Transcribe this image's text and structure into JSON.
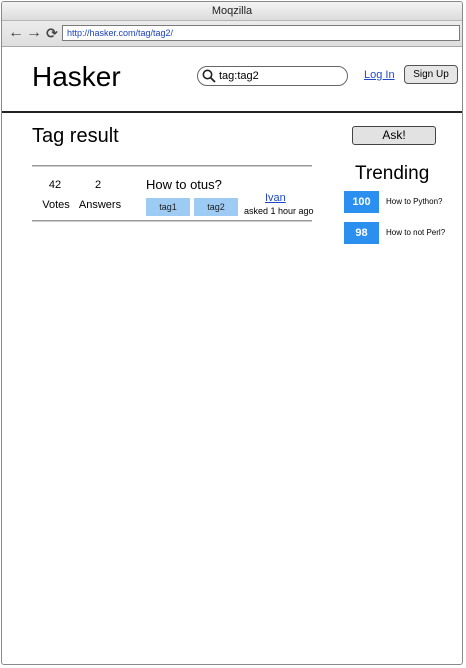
{
  "browser": {
    "title": "Moqzilla",
    "url": "http://hasker.com/tag/tag2/"
  },
  "header": {
    "brand": "Hasker",
    "search_value": "tag:tag2",
    "login_label": "Log In",
    "signup_label": "Sign Up"
  },
  "main": {
    "page_title": "Tag result",
    "ask_label": "Ask!",
    "questions": [
      {
        "votes": "42",
        "votes_label": "Votes",
        "answers": "2",
        "answers_label": "Answers",
        "title": "How to otus?",
        "tags": [
          "tag1",
          "tag2"
        ],
        "author": "Ivan",
        "asked": "asked 1 hour ago"
      }
    ]
  },
  "trending": {
    "title": "Trending",
    "items": [
      {
        "score": "100",
        "question": "How to Python?"
      },
      {
        "score": "98",
        "question": "How to not Perl?"
      }
    ]
  },
  "colors": {
    "accent": "#2b8ff0",
    "tag_bg": "#9ecbf4",
    "link": "#1f48c9"
  }
}
